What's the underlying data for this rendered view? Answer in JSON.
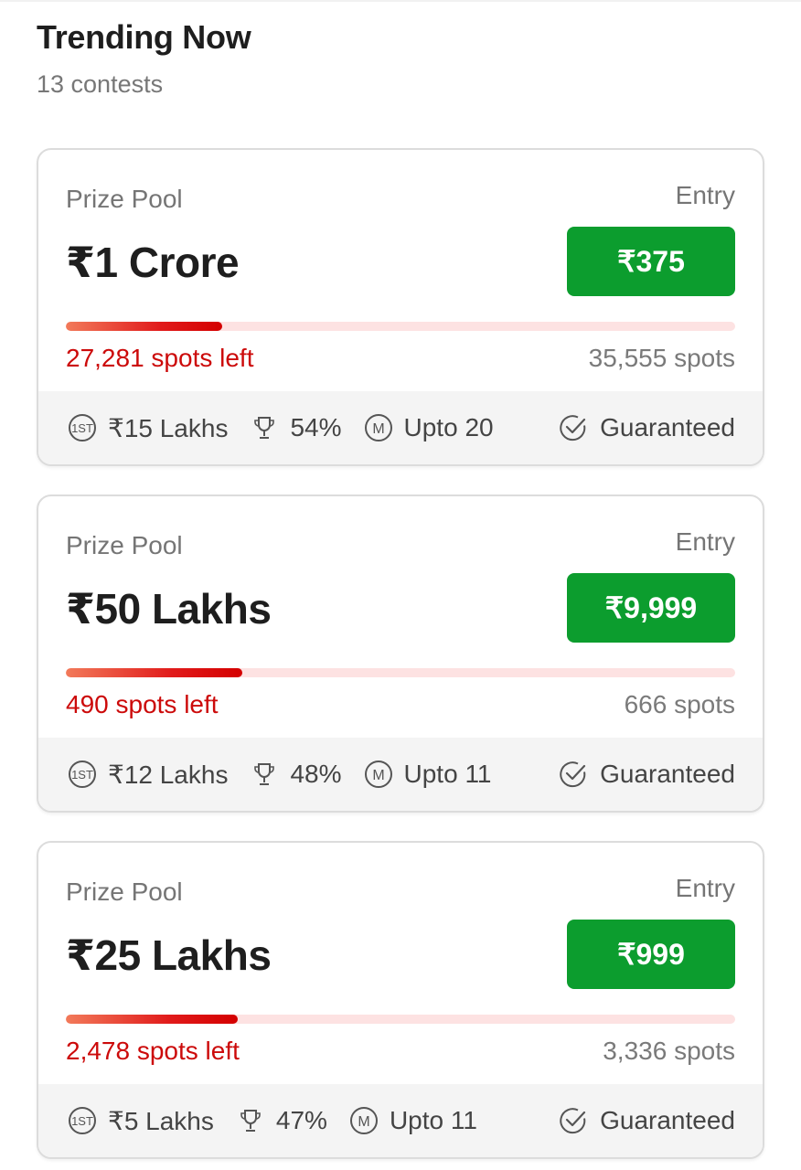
{
  "header": {
    "title": "Trending Now",
    "subtitle": "13 contests"
  },
  "colors": {
    "entry_button": "#0c9d2e",
    "spots_left_text": "#cc0a0a",
    "progress_track": "#fde2e2",
    "progress_fill": "#e11b1b"
  },
  "cards": [
    {
      "prize_label": "Prize Pool",
      "prize_value": "₹1 Crore",
      "entry_label": "Entry",
      "entry_fee": "₹375",
      "fill_fraction": 0.233,
      "spots_left": "27,281 spots left",
      "spots_total": "35,555 spots",
      "first_prize_icon": "first-place-icon",
      "first_prize": "₹15 Lakhs",
      "win_icon": "trophy-icon",
      "win_percent": "54%",
      "multi_icon": "multi-entry-icon",
      "multi_entry": "Upto 20",
      "guarantee_icon": "check-circle-icon",
      "guarantee": "Guaranteed"
    },
    {
      "prize_label": "Prize Pool",
      "prize_value": "₹50 Lakhs",
      "entry_label": "Entry",
      "entry_fee": "₹9,999",
      "fill_fraction": 0.264,
      "spots_left": "490 spots left",
      "spots_total": "666 spots",
      "first_prize_icon": "first-place-icon",
      "first_prize": "₹12 Lakhs",
      "win_icon": "trophy-icon",
      "win_percent": "48%",
      "multi_icon": "multi-entry-icon",
      "multi_entry": "Upto 11",
      "guarantee_icon": "check-circle-icon",
      "guarantee": "Guaranteed"
    },
    {
      "prize_label": "Prize Pool",
      "prize_value": "₹25 Lakhs",
      "entry_label": "Entry",
      "entry_fee": "₹999",
      "fill_fraction": 0.257,
      "spots_left": "2,478 spots left",
      "spots_total": "3,336 spots",
      "first_prize_icon": "first-place-icon",
      "first_prize": "₹5 Lakhs",
      "win_icon": "trophy-icon",
      "win_percent": "47%",
      "multi_icon": "multi-entry-icon",
      "multi_entry": "Upto 11",
      "guarantee_icon": "check-circle-icon",
      "guarantee": "Guaranteed"
    }
  ]
}
